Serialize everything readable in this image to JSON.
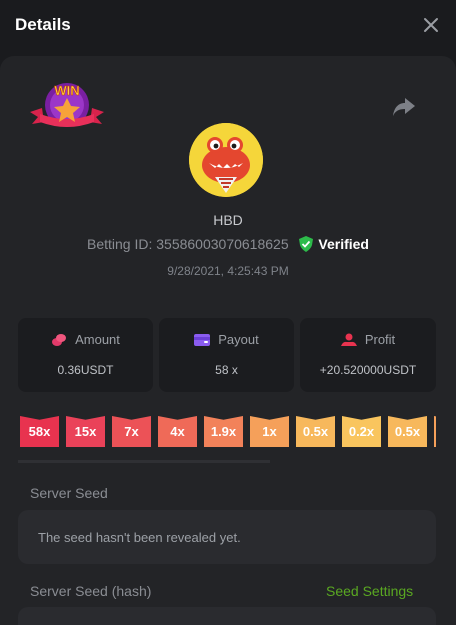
{
  "header": {
    "title": "Details",
    "close_icon": "close-icon"
  },
  "bet": {
    "badge_text": "WIN",
    "username": "HBD",
    "betting_id_label": "Betting ID:",
    "betting_id": "35586003070618625",
    "verified_label": "Verified",
    "datetime": "9/28/2021, 4:25:43 PM"
  },
  "stats": [
    {
      "label": "Amount",
      "value": "0.36USDT",
      "icon": "coins-icon"
    },
    {
      "label": "Payout",
      "value": "58 x",
      "icon": "wallet-icon"
    },
    {
      "label": "Profit",
      "value": "+20.520000USDT",
      "icon": "profit-icon"
    }
  ],
  "multipliers": {
    "items": [
      "58x",
      "15x",
      "7x",
      "4x",
      "1.9x",
      "1x",
      "0.5x",
      "0.2x",
      "0.5x"
    ],
    "colors": [
      "#e8334f",
      "#ea4259",
      "#ec5257",
      "#ef6a58",
      "#f2825a",
      "#f5a05a",
      "#f7b85c",
      "#f9c55e",
      "#f7b85c",
      "#f5a05a"
    ]
  },
  "server_seed": {
    "label": "Server Seed",
    "value": "The seed hasn't been revealed yet."
  },
  "server_seed_hash": {
    "label": "Server Seed (hash)",
    "settings_label": "Seed Settings",
    "value": ""
  },
  "colors": {
    "accent_green": "#5aa822",
    "verified_green": "#2dbb4a",
    "background": "#1a1b1e",
    "panel": "#232427"
  }
}
